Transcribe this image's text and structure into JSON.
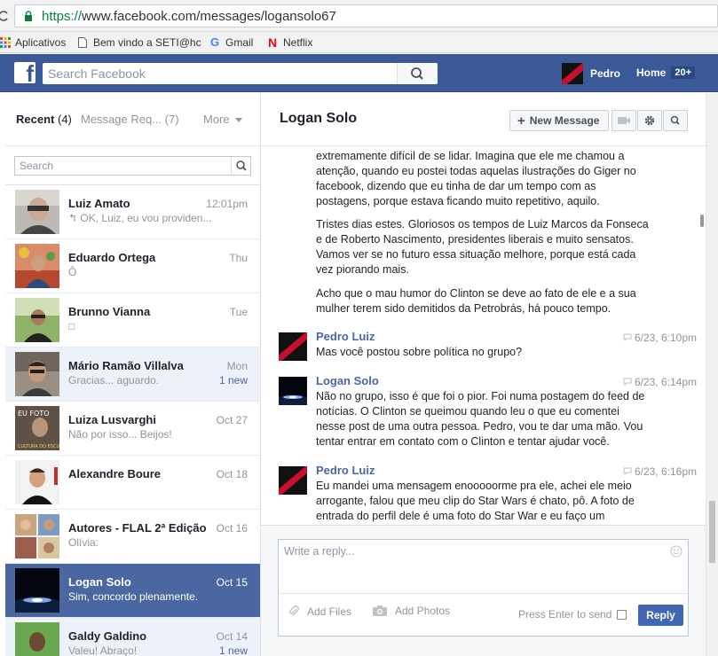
{
  "browser": {
    "url_scheme": "https://",
    "url_rest": "www.facebook.com/messages/logansolo67",
    "bookmarks": [
      {
        "label": "Aplicativos",
        "icon": "apps-grid-icon"
      },
      {
        "label": "Bem vindo a SETI@hc",
        "icon": "page-icon"
      },
      {
        "label": "Gmail",
        "icon": "google-g-icon"
      },
      {
        "label": "Netflix",
        "icon": "netflix-n-icon"
      }
    ]
  },
  "fb": {
    "search_placeholder": "Search Facebook",
    "user_name": "Pedro",
    "home_label": "Home",
    "home_count": "20+"
  },
  "sidebar": {
    "tabs": {
      "recent_label": "Recent",
      "recent_count": "(4)",
      "requests_label": "Message Req...",
      "requests_count": "(7)",
      "more_label": "More"
    },
    "search_placeholder": "Search",
    "threads": [
      {
        "name": "Luiz Amato",
        "time": "12:01pm",
        "snippet": "↰ OK, Luiz, eu vou providen...",
        "new": "",
        "state": "read"
      },
      {
        "name": "Eduardo Ortega",
        "time": "Thu",
        "snippet": "Ô",
        "new": "",
        "state": "read"
      },
      {
        "name": "Brunno Vianna",
        "time": "Tue",
        "snippet": "□",
        "new": "",
        "state": "read"
      },
      {
        "name": "Mário Ramão Villalva",
        "time": "Mon",
        "snippet": "Gracias... aguardo.",
        "new": "1 new",
        "state": "unread"
      },
      {
        "name": "Luiza Lusvarghi",
        "time": "Oct 27",
        "snippet": "Não por isso... Beijos!",
        "new": "",
        "state": "read"
      },
      {
        "name": "Alexandre Boure",
        "time": "Oct 18",
        "snippet": "",
        "new": "",
        "state": "read"
      },
      {
        "name": "Autores - FLAL 2ª Edição",
        "time": "Oct 16",
        "snippet": "Olívia:",
        "new": "",
        "state": "read"
      },
      {
        "name": "Logan Solo",
        "time": "Oct 15",
        "snippet": "Sim, concordo plenamente.",
        "new": "",
        "state": "selected"
      },
      {
        "name": "Galdy Galdino",
        "time": "Oct 14",
        "snippet": "Valeu! Abraço!",
        "new": "1 new",
        "state": "unread"
      }
    ]
  },
  "conversation": {
    "title": "Logan Solo",
    "new_message_label": "New Message",
    "paragraphs": [
      "extremamente difícil de se lidar. Imagina que ele me chamou a atenção, quando eu postei todas aquelas ilustrações do Giger no facebook, dizendo que eu tinha de dar um tempo com as postagens, porque estava ficando muito repetitivo, aquilo.",
      "Tristes dias estes. Gloriosos os tempos de Luiz Marcos da Fonseca e de Roberto Nascimento, presidentes liberais e muito sensatos. Vamos ver se no futuro essa situação melhore, porque está cada vez piorando mais.",
      "Acho que o mau humor do Clinton se deve ao fato de ele e a sua mulher terem sido demitidos da Petrobrás, há pouco tempo."
    ],
    "messages": [
      {
        "author": "Pedro Luiz",
        "time": "6/23, 6:10pm",
        "text": "Mas você postou sobre política no grupo?"
      },
      {
        "author": "Logan Solo",
        "time": "6/23, 6:14pm",
        "text": "Não no grupo, isso é que foi o pior. Foi numa postagem do feed de notícias. O Clinton se queimou quando leu o que eu comentei nesse post de uma outra pessoa. Pedro, vou te dar uma mão. Vou tentar entrar em contato com o Clinton e tentar ajudar você."
      },
      {
        "author": "Pedro Luiz",
        "time": "6/23, 6:16pm",
        "text": "Eu mandei uma mensagem enooooorme pra ele, achei ele meio arrogante, falou que meu clip do Star Wars é chato, pô. A foto de entrada do perfil dele é uma foto do Star War e eu faço um"
      }
    ]
  },
  "reply": {
    "placeholder": "Write a reply...",
    "add_files": "Add Files",
    "add_photos": "Add Photos",
    "press_enter": "Press Enter to send",
    "reply_label": "Reply"
  },
  "colors": {
    "fb_blue": "#3b5998",
    "selected_thread": "#4b67a1",
    "link_blue": "#4b67a1"
  }
}
